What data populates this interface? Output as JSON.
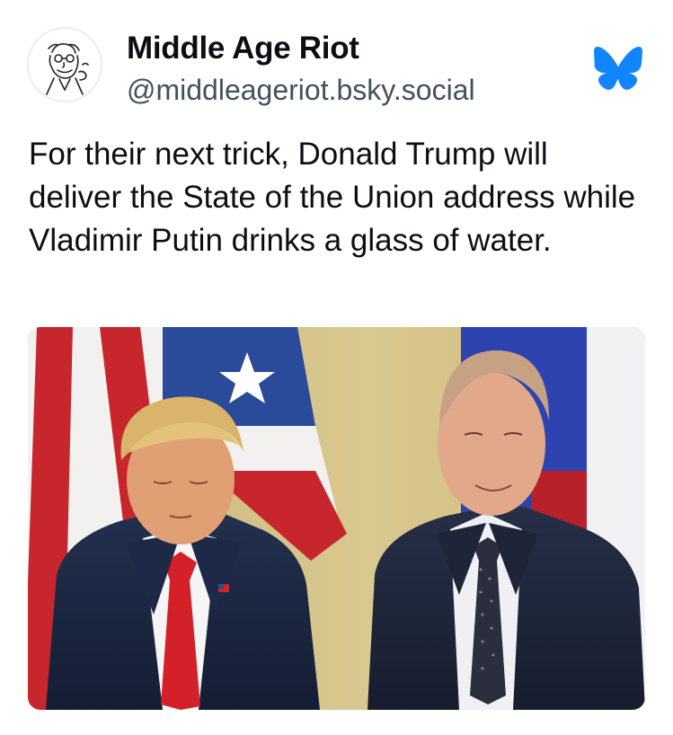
{
  "author": {
    "display_name": "Middle Age Riot",
    "handle": "@middleageriot.bsky.social"
  },
  "post": {
    "text": "For their next trick, Donald Trump will deliver the State of the Union address while Vladimir Putin drinks a glass of water."
  },
  "icons": {
    "avatar": "cartoon-man-avatar-icon",
    "platform": "bluesky-butterfly-icon"
  },
  "colors": {
    "bluesky_blue": "#1185fe",
    "handle_gray": "#43505e"
  }
}
